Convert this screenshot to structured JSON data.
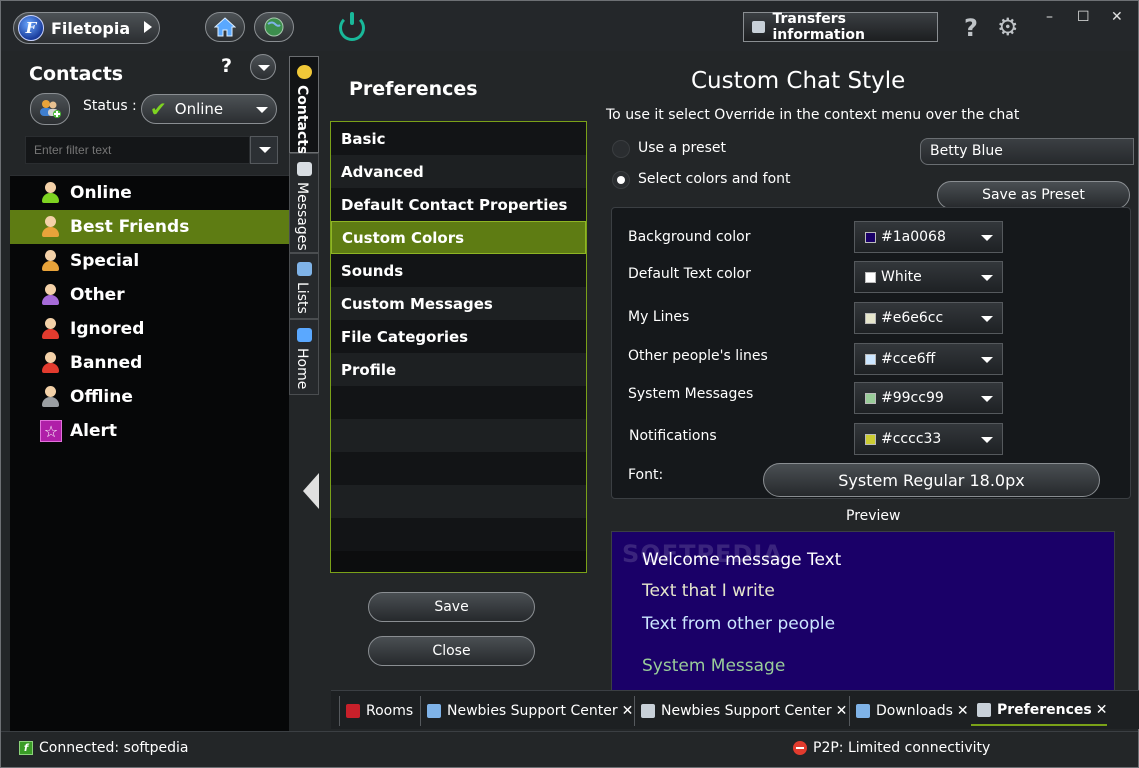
{
  "app": {
    "name": "Filetopia",
    "logo_letter": "F"
  },
  "toolbar": {
    "transfers_label": "Transfers information",
    "help_glyph": "?",
    "gear_glyph": "⚙",
    "minimize_glyph": "–",
    "maximize_glyph": "☐",
    "close_glyph": "✕",
    "icons": [
      "home-icon",
      "globe-icon",
      "power-icon"
    ]
  },
  "contacts": {
    "title": "Contacts",
    "help_glyph": "?",
    "status_label": "Status :",
    "status_value": "Online",
    "status_check": "✔",
    "filter_placeholder": "Enter filter text",
    "groups": [
      {
        "label": "Online",
        "color": "#7ed321"
      },
      {
        "label": "Best Friends",
        "color": "#e8a33a",
        "selected": true
      },
      {
        "label": "Special",
        "color": "#e8a33a"
      },
      {
        "label": "Other",
        "color": "#a66bd9"
      },
      {
        "label": "Ignored",
        "color": "#e23b2e"
      },
      {
        "label": "Banned",
        "color": "#e23b2e"
      },
      {
        "label": "Offline",
        "color": "#9a9ea2"
      },
      {
        "label": "Alert",
        "color": "#b01fa8",
        "star": "☆"
      }
    ]
  },
  "side_tabs": [
    {
      "label": "Contacts",
      "active": true
    },
    {
      "label": "Messages"
    },
    {
      "label": "Lists"
    },
    {
      "label": "Home"
    }
  ],
  "preferences": {
    "title": "Preferences",
    "items": [
      "Basic",
      "Advanced",
      "Default Contact Properties",
      "Custom Colors",
      "Sounds",
      "Custom Messages",
      "File Categories",
      "Profile"
    ],
    "selected_index": 3,
    "save_label": "Save",
    "close_label": "Close"
  },
  "chat_style": {
    "title": "Custom Chat Style",
    "hint": "To use it select Override in the context menu over the chat",
    "use_preset_label": "Use a preset",
    "select_colors_label": "Select colors and font",
    "preset_value": "Betty Blue",
    "save_preset_label": "Save as Preset",
    "colors": [
      {
        "label": "Background color",
        "value": "#1a0068",
        "swatch": "#1a0068"
      },
      {
        "label": "Default Text color",
        "value": "White",
        "swatch": "#ffffff"
      },
      {
        "label": "My Lines",
        "value": "#e6e6cc",
        "swatch": "#e6e6cc"
      },
      {
        "label": "Other people's lines",
        "value": "#cce6ff",
        "swatch": "#cce6ff"
      },
      {
        "label": "System Messages",
        "value": "#99cc99",
        "swatch": "#99cc99"
      },
      {
        "label": "Notifications",
        "value": "#cccc33",
        "swatch": "#cccc33"
      }
    ],
    "font_label": "Font:",
    "font_value": "System Regular  18.0px",
    "preview_label": "Preview",
    "preview": {
      "watermark": "SOFTPEDIA",
      "welcome": "Welcome message Text",
      "my_text": "Text that I write",
      "other_text": "Text from other people",
      "system": "System Message"
    }
  },
  "bottom_tabs": [
    {
      "label": "Rooms",
      "closable": false,
      "icon_color": "#c8202a"
    },
    {
      "label": "Newbies Support Center",
      "closable": true,
      "icon_color": "#7fb3e8"
    },
    {
      "label": "Newbies Support Center",
      "closable": true,
      "icon_color": "#c8d0d8"
    },
    {
      "label": "Downloads",
      "closable": true,
      "icon_color": "#7fb3e8"
    },
    {
      "label": "Preferences",
      "closable": true,
      "icon_color": "#c8d0d8",
      "active": true
    }
  ],
  "close_x": "✕",
  "status_bar": {
    "connected": "Connected: softpedia",
    "p2p": "P2P: Limited connectivity"
  }
}
